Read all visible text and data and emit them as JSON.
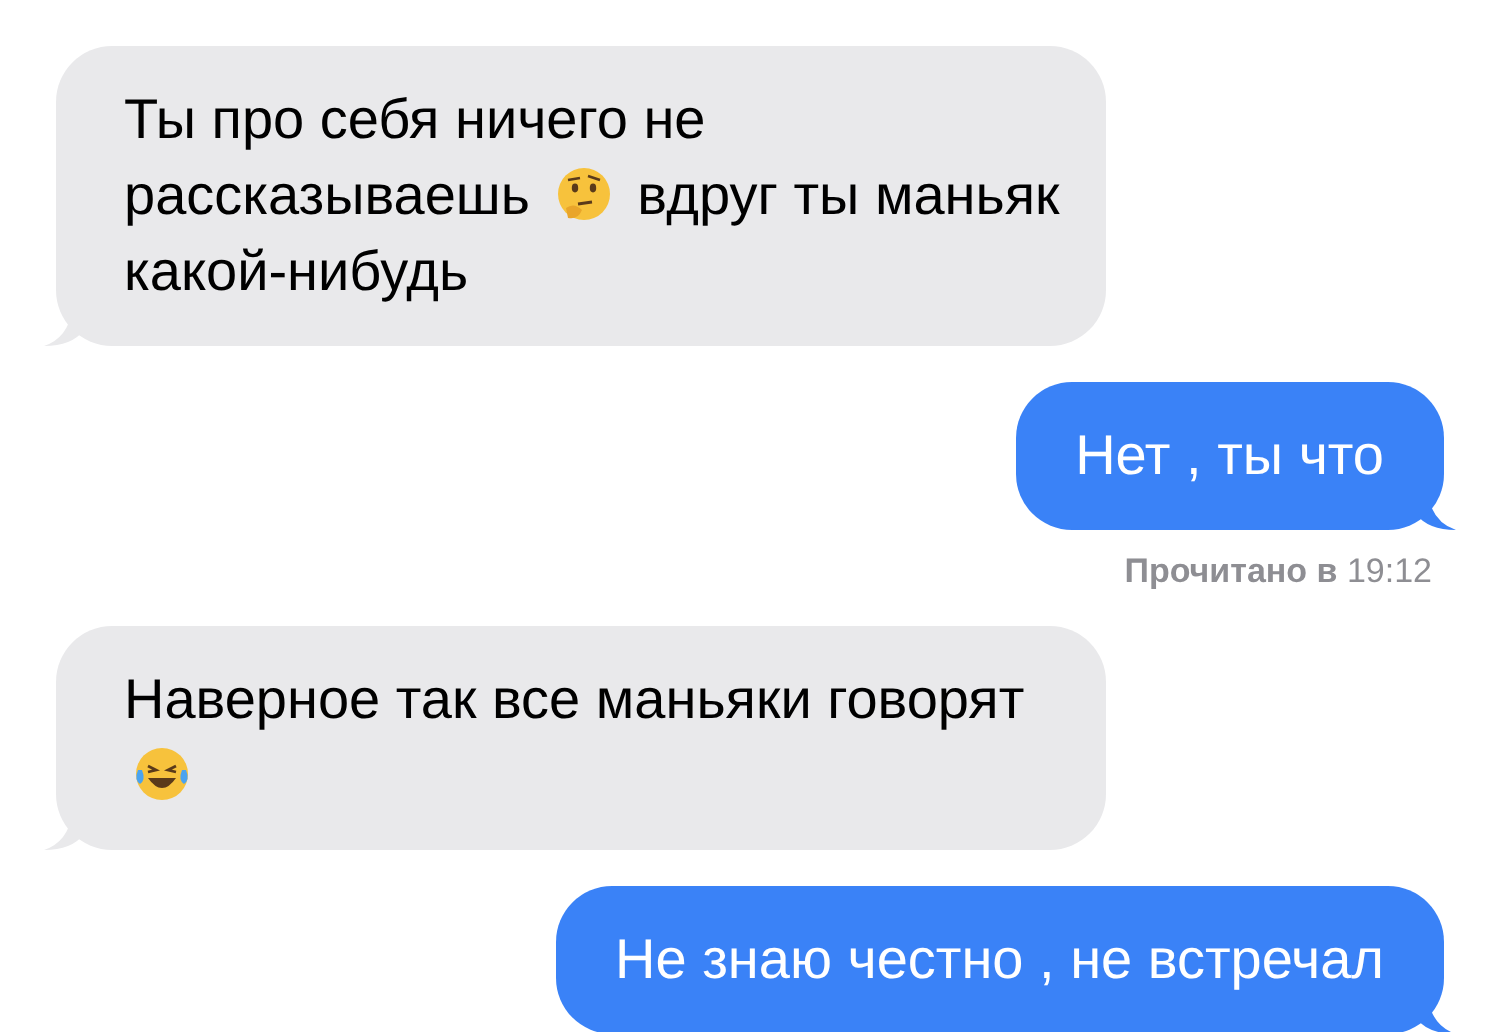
{
  "messages": [
    {
      "kind": "incoming",
      "parts": [
        {
          "kind": "text",
          "text": "Ты про себя ничего не рассказываешь"
        },
        {
          "kind": "thinking-emoji"
        },
        {
          "kind": "text",
          "text": "вдруг ты маньяк какой-нибудь"
        }
      ]
    },
    {
      "kind": "outgoing",
      "parts": [
        {
          "kind": "text",
          "text": "Нет , ты что"
        }
      ]
    },
    {
      "kind": "receipt",
      "text": "**Прочитано в** 19:12"
    },
    {
      "kind": "incoming",
      "parts": [
        {
          "kind": "text",
          "text": "Наверное так все маньяки говорят"
        },
        {
          "kind": "laughing-emoji"
        }
      ]
    },
    {
      "kind": "outgoing",
      "parts": [
        {
          "kind": "text",
          "text": "Не знаю честно , не встречал"
        }
      ]
    }
  ]
}
